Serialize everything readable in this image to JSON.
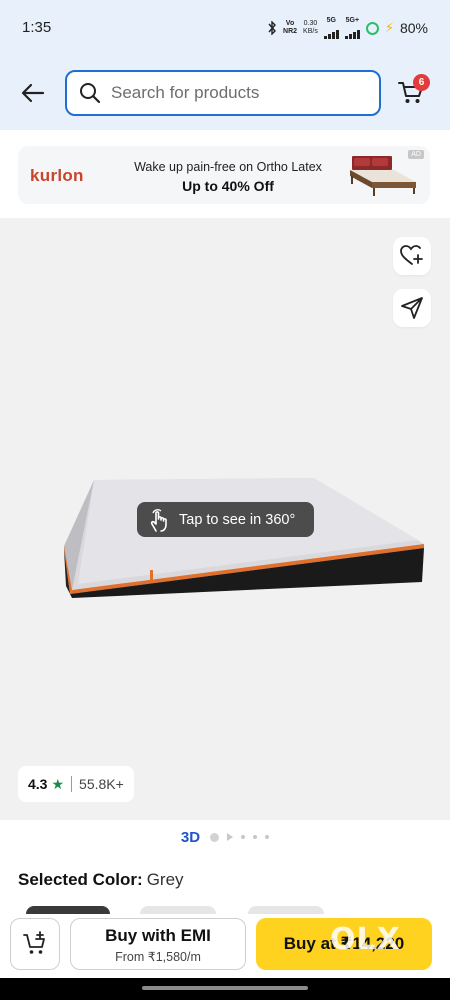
{
  "status_bar": {
    "time": "1:35",
    "volte_top": "Vo",
    "volte_bottom": "NR2",
    "speed_top": "0.30",
    "speed_bottom": "KB/s",
    "net1": "5G",
    "net2": "5G+",
    "battery": "80%"
  },
  "header": {
    "back_icon": "arrow-left-icon",
    "search": {
      "placeholder": "Search for products",
      "value": ""
    },
    "cart": {
      "icon": "cart-icon",
      "badge": "6"
    }
  },
  "ad": {
    "brand": "kurlon",
    "tagline": "Wake up pain-free on Ortho Latex",
    "offer": "Up to 40% Off",
    "tag": "AD"
  },
  "product": {
    "wishlist_icon": "heart-plus-icon",
    "share_icon": "share-icon",
    "tap_label": "Tap to see in 360°",
    "rating": {
      "value": "4.3",
      "star": "★",
      "count": "55.8K+"
    }
  },
  "carousel": {
    "label_3d": "3D"
  },
  "selected_color": {
    "label": "Selected Color:",
    "value": "Grey"
  },
  "bottom_bar": {
    "emi_title": "Buy with EMI",
    "emi_sub": "From ₹1,580/m",
    "buy_label": "Buy at ₹14,220"
  },
  "watermark": "OLX",
  "colors": {
    "header_bg": "#e8f1fb",
    "accent_blue": "#1f6fd1",
    "badge_red": "#e23b3b",
    "buy_yellow": "#ffd21f",
    "rating_green": "#1a8a4a",
    "mattress_orange": "#e0702c"
  }
}
